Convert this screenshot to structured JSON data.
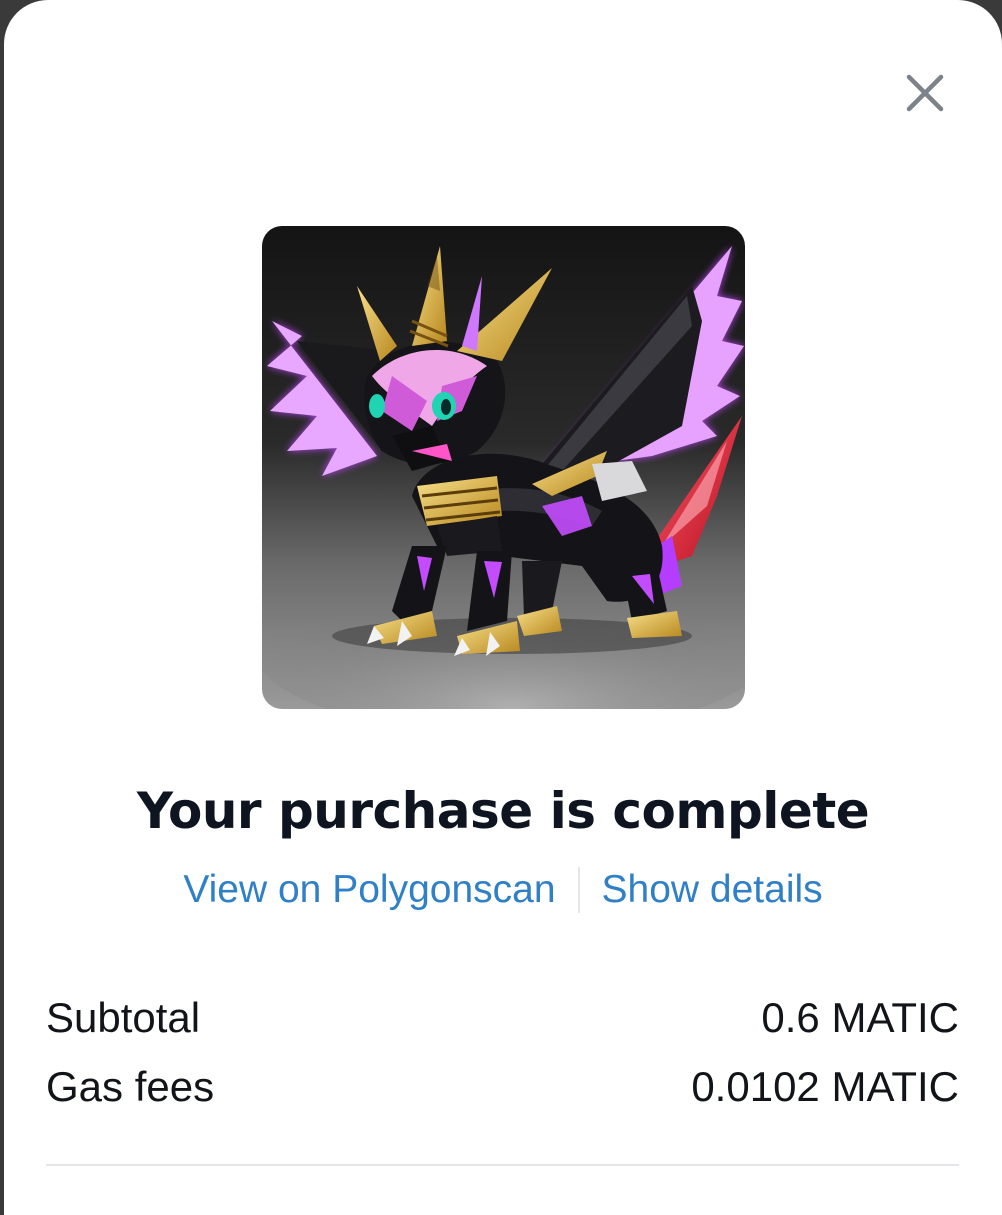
{
  "modal": {
    "close_icon": "close-icon",
    "nft_image": "purple-armored-dragon-creature",
    "title": "Your purchase is complete",
    "links": {
      "explorer": "View on Polygonscan",
      "details": "Show details"
    },
    "summary": {
      "subtotal_label": "Subtotal",
      "subtotal_value": "0.6 MATIC",
      "gas_label": "Gas fees",
      "gas_value": "0.0102 MATIC"
    }
  },
  "colors": {
    "link": "#2f80c7",
    "title": "#0e1520",
    "text": "#111418",
    "divider": "#e4e6ea",
    "close_icon": "#7d838b",
    "nft_glow": "#c44cff"
  }
}
